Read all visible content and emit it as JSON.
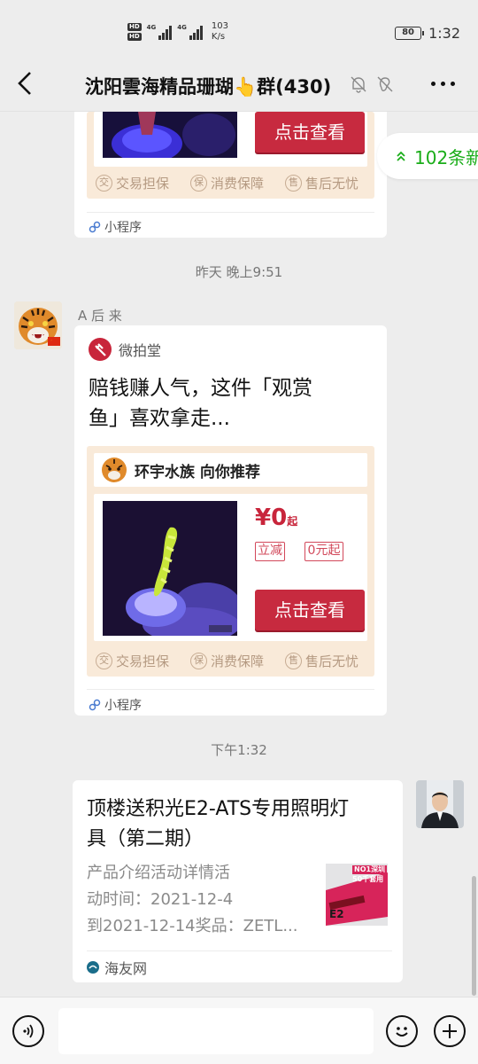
{
  "status_bar": {
    "hd1": "HD",
    "hd2": "HD",
    "net1": "4G",
    "net2": "4G",
    "speed_value": "103",
    "speed_unit": "K/s",
    "battery": "80",
    "time": "1:32"
  },
  "header": {
    "title": "沈阳雲海精品珊瑚👆群(430)"
  },
  "new_messages": {
    "label": "102条新"
  },
  "top_card": {
    "button": "点击查看",
    "guarantees": [
      "交易担保",
      "消费保障",
      "售后无忧"
    ],
    "guarantee_icons": [
      "交",
      "保",
      "售"
    ],
    "footer": "小程序"
  },
  "timestamps": {
    "t1": "昨天 晚上9:51",
    "t2": "下午1:32"
  },
  "message_a": {
    "sender": "A 后 来",
    "app_name": "微拍堂",
    "title_line1": "赔钱赚人气，这件「观赏",
    "title_line2": "鱼」喜欢拿走...",
    "shop": "环宇水族 向你推荐",
    "price_symbol": "¥0",
    "price_suffix": "起",
    "tags": [
      "立减",
      "0元起"
    ],
    "button": "点击查看",
    "guarantees": [
      "交易担保",
      "消费保障",
      "售后无忧"
    ],
    "guarantee_icons": [
      "交",
      "保",
      "售"
    ],
    "footer": "小程序"
  },
  "message_b": {
    "title_line1": "顶楼送积光E2-ATS专用照明灯",
    "title_line2": "具（第二期）",
    "desc_line1": "产品介绍活动详情活",
    "desc_line2": "动时间：2021-12-4",
    "desc_line3": "到2021-12-14奖品：ZETL...",
    "thumb_text1": "NO1深圳",
    "thumb_text2": "50千套用",
    "thumb_text3": "E2",
    "source": "海友网"
  },
  "colors": {
    "accent_green": "#1aad19",
    "cta_red": "#c72a3f",
    "card_beige": "#f9ead9"
  }
}
